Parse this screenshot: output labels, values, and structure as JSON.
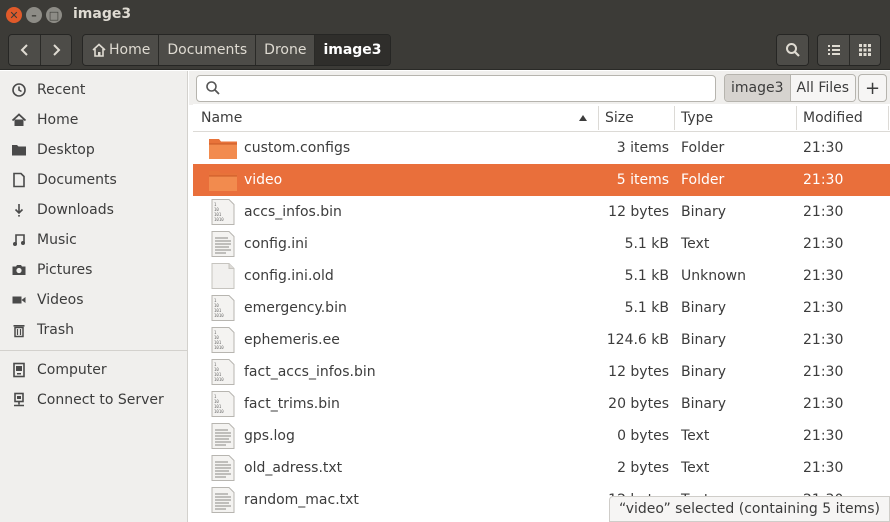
{
  "window": {
    "title": "image3"
  },
  "toolbar": {
    "back_icon": "chevron-left-icon",
    "forward_icon": "chevron-right-icon",
    "breadcrumbs": [
      "Home",
      "Documents",
      "Drone",
      "image3"
    ],
    "search_icon": "search-icon",
    "list_view_icon": "list-view-icon",
    "grid_view_icon": "grid-view-icon"
  },
  "sidebar": {
    "items": [
      {
        "label": "Recent",
        "icon": "clock-icon"
      },
      {
        "label": "Home",
        "icon": "home-icon"
      },
      {
        "label": "Desktop",
        "icon": "folder-icon"
      },
      {
        "label": "Documents",
        "icon": "document-icon"
      },
      {
        "label": "Downloads",
        "icon": "download-icon"
      },
      {
        "label": "Music",
        "icon": "music-icon"
      },
      {
        "label": "Pictures",
        "icon": "camera-icon"
      },
      {
        "label": "Videos",
        "icon": "video-icon"
      },
      {
        "label": "Trash",
        "icon": "trash-icon"
      },
      {
        "label": "Computer",
        "icon": "computer-icon"
      },
      {
        "label": "Connect to Server",
        "icon": "server-icon"
      }
    ]
  },
  "search": {
    "placeholder": "",
    "scope": [
      "image3",
      "All Files"
    ],
    "add_label": "+"
  },
  "columns": {
    "name": "Name",
    "size": "Size",
    "type": "Type",
    "modified": "Modified"
  },
  "files": [
    {
      "name": "custom.configs",
      "size": "3 items",
      "type": "Folder",
      "modified": "21:30",
      "kind": "folder"
    },
    {
      "name": "video",
      "size": "5 items",
      "type": "Folder",
      "modified": "21:30",
      "kind": "folder",
      "selected": true
    },
    {
      "name": "accs_infos.bin",
      "size": "12 bytes",
      "type": "Binary",
      "modified": "21:30",
      "kind": "binary"
    },
    {
      "name": "config.ini",
      "size": "5.1 kB",
      "type": "Text",
      "modified": "21:30",
      "kind": "text"
    },
    {
      "name": "config.ini.old",
      "size": "5.1 kB",
      "type": "Unknown",
      "modified": "21:30",
      "kind": "unknown"
    },
    {
      "name": "emergency.bin",
      "size": "5.1 kB",
      "type": "Binary",
      "modified": "21:30",
      "kind": "binary"
    },
    {
      "name": "ephemeris.ee",
      "size": "124.6 kB",
      "type": "Binary",
      "modified": "21:30",
      "kind": "binary"
    },
    {
      "name": "fact_accs_infos.bin",
      "size": "12 bytes",
      "type": "Binary",
      "modified": "21:30",
      "kind": "binary"
    },
    {
      "name": "fact_trims.bin",
      "size": "20 bytes",
      "type": "Binary",
      "modified": "21:30",
      "kind": "binary"
    },
    {
      "name": "gps.log",
      "size": "0 bytes",
      "type": "Text",
      "modified": "21:30",
      "kind": "text"
    },
    {
      "name": "old_adress.txt",
      "size": "2 bytes",
      "type": "Text",
      "modified": "21:30",
      "kind": "text"
    },
    {
      "name": "random_mac.txt",
      "size": "12 bytes",
      "type": "Text",
      "modified": "21:30",
      "kind": "text"
    }
  ],
  "status": {
    "text": "“video” selected  (containing 5 items)"
  },
  "colors": {
    "accent": "#e96f3b",
    "folder": "#e8733a",
    "titlebar": "#3c3b37",
    "sidebar": "#f0efed"
  }
}
